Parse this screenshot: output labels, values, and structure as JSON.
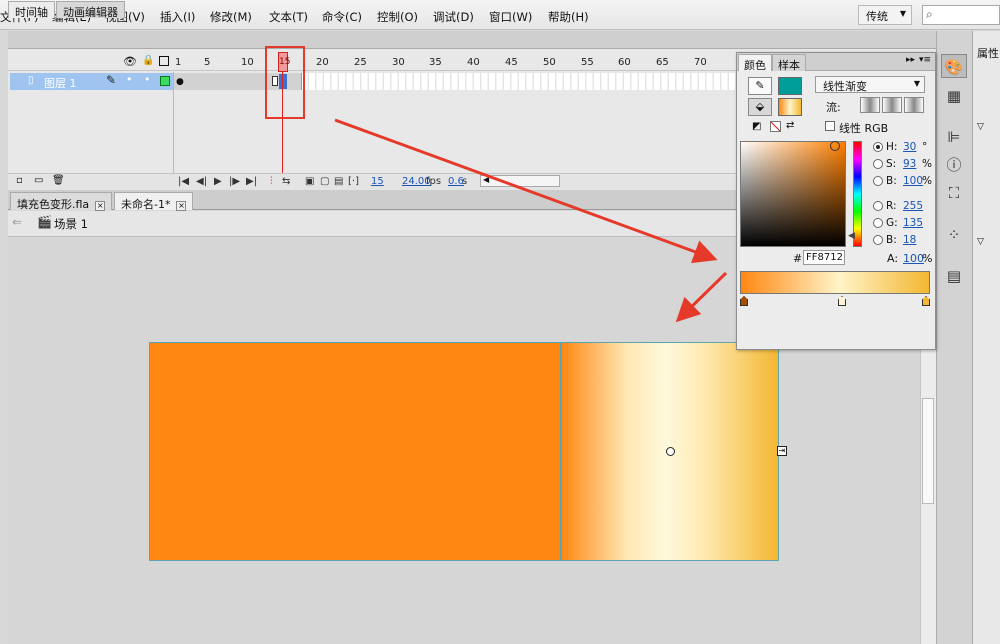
{
  "menu": [
    "文件(F)",
    "编辑(E)",
    "视图(V)",
    "插入(I)",
    "修改(M)",
    "文本(T)",
    "命令(C)",
    "控制(O)",
    "调试(D)",
    "窗口(W)",
    "帮助(H)"
  ],
  "workspace": "传统",
  "timeline": {
    "tabs": [
      "时间轴",
      "动画编辑器"
    ],
    "layer_name": "图层 1",
    "ruler": [
      "1",
      "5",
      "10",
      "15",
      "20",
      "25",
      "30",
      "35",
      "40",
      "45",
      "50",
      "55",
      "60",
      "65",
      "70"
    ],
    "current_frame": "15",
    "fps": "24.00",
    "fps_unit": "fps",
    "time": "0.6",
    "time_unit": "s"
  },
  "documents": {
    "tabs": [
      "填充色变形.fla",
      "未命名-1*"
    ],
    "active": 1
  },
  "breadcrumb": {
    "scene": "场景 1"
  },
  "color_panel": {
    "tabs": [
      "颜色",
      "样本"
    ],
    "fill_type": "线性渐变",
    "flow_label": "流:",
    "linear_rgb_label": "线性 RGB",
    "hex_prefix": "#",
    "hex": "FF8712",
    "fields": [
      {
        "label": "H:",
        "value": "30",
        "unit": "°",
        "selected": true
      },
      {
        "label": "S:",
        "value": "93",
        "unit": "%",
        "selected": false
      },
      {
        "label": "B:",
        "value": "100",
        "unit": "%",
        "selected": false
      },
      {
        "label": "R:",
        "value": "255",
        "unit": "",
        "selected": false
      },
      {
        "label": "G:",
        "value": "135",
        "unit": "",
        "selected": false
      },
      {
        "label": "B:",
        "value": "18",
        "unit": "",
        "selected": false
      }
    ],
    "alpha_label": "A:",
    "alpha": "100",
    "alpha_unit": "%",
    "colors": {
      "stroke": "#009e9a",
      "gradient_start": "#ff8712",
      "gradient_mid": "#fff4c8",
      "gradient_end": "#f3b732"
    }
  },
  "right_panel": {
    "title": "属性"
  },
  "stage": {
    "solid_fill": "#ff8712"
  },
  "annotation": {
    "color": "#e53a2a"
  }
}
